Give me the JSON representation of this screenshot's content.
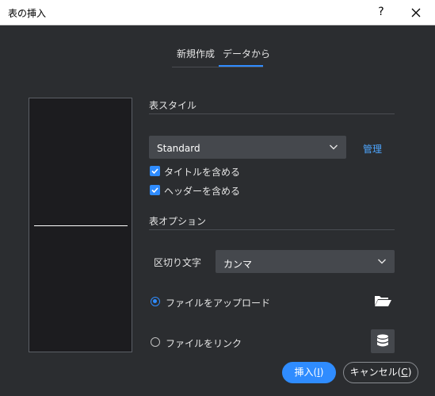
{
  "window": {
    "title": "表の挿入",
    "help": "?"
  },
  "tabs": [
    {
      "label": "新規作成",
      "active": false
    },
    {
      "label": "データから",
      "active": true
    }
  ],
  "table_style": {
    "title": "表スタイル",
    "style_value": "Standard",
    "manage_label": "管理",
    "include_title_label": "タイトルを含める",
    "include_title_checked": true,
    "include_header_label": "ヘッダーを含める",
    "include_header_checked": true
  },
  "table_options": {
    "title": "表オプション",
    "delimiter_label": "区切り文字",
    "delimiter_value": "カンマ",
    "upload_label": "ファイルをアップロード",
    "upload_selected": true,
    "link_label": "ファイルをリンク",
    "link_selected": false
  },
  "footer": {
    "insert_label": "挿入(",
    "insert_key": "I",
    "insert_suffix": ")",
    "cancel_label": "キャンセル(",
    "cancel_key": "C",
    "cancel_suffix": ")"
  },
  "colors": {
    "accent": "#2f8cff",
    "background": "#2b2d30",
    "input": "#45484d",
    "link": "#4ea6ff"
  }
}
